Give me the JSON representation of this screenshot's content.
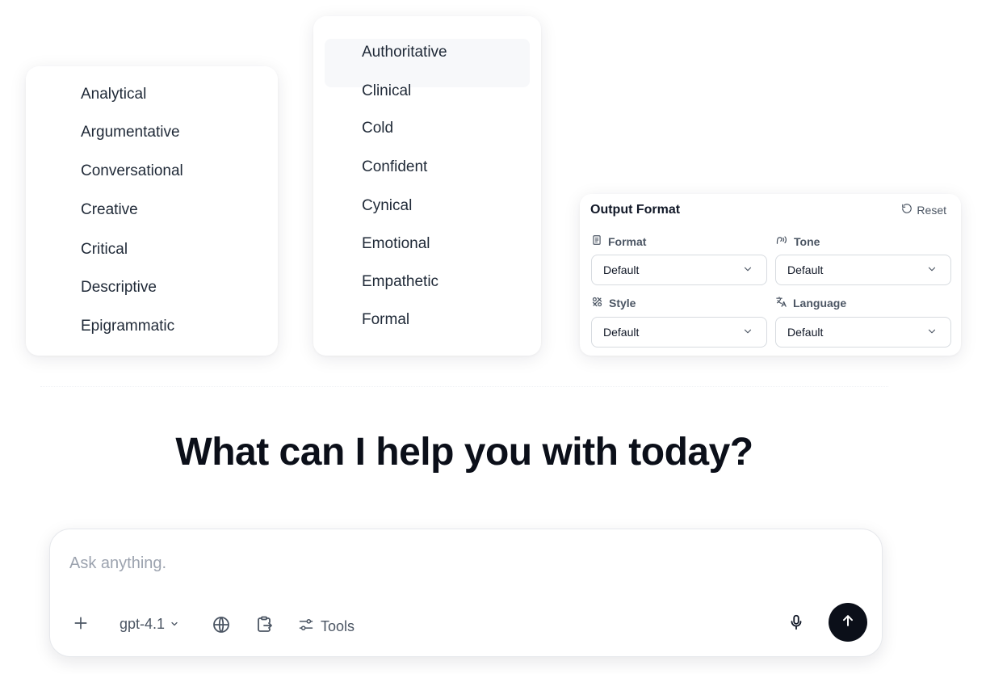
{
  "tone_list_left": [
    "Analytical",
    "Argumentative",
    "Conversational",
    "Creative",
    "Critical",
    "Descriptive",
    "Epigrammatic"
  ],
  "tone_list_right": [
    "Authoritative",
    "Clinical",
    "Cold",
    "Confident",
    "Cynical",
    "Emotional",
    "Empathetic",
    "Formal"
  ],
  "output_format": {
    "title": "Output Format",
    "reset_label": "Reset",
    "fields": [
      {
        "label": "Format",
        "value": "Default",
        "icon": "document-icon"
      },
      {
        "label": "Tone",
        "value": "Default",
        "icon": "voice-icon"
      },
      {
        "label": "Style",
        "value": "Default",
        "icon": "style-icon"
      },
      {
        "label": "Language",
        "value": "Default",
        "icon": "translate-icon"
      }
    ]
  },
  "headline": "What can I help you with today?",
  "composer": {
    "placeholder": "Ask anything.",
    "model": "gpt-4.1",
    "tools_label": "Tools"
  }
}
